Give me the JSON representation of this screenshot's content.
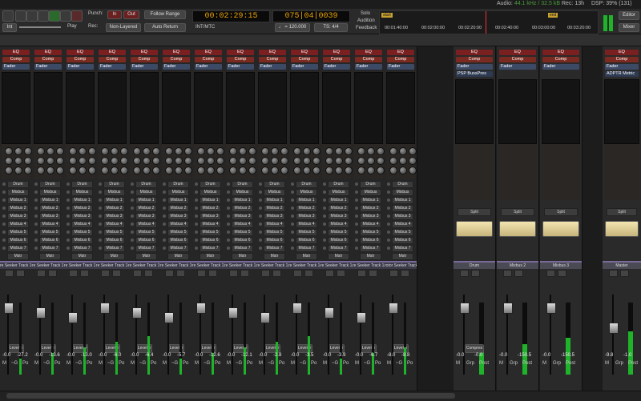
{
  "status": {
    "audio_label": "Audio:",
    "audio_val": "44.1 kHz / 32.5 kB",
    "rec": "Rec: 13h",
    "dsp": "DSP: 39% (131)"
  },
  "toolbar": {
    "int": "Int",
    "play": "Play",
    "punch": "Punch:",
    "punch_in": "In",
    "punch_out": "Out",
    "rec_label": "Rec:",
    "rec_mode": "Non-Layered",
    "follow_range": "Follow Range",
    "auto_return": "Auto Return",
    "timecode": "00:02:29:15",
    "int_mtc": "INT/MTC",
    "bars": "075|04|0039",
    "tempo": "♩ = 120.000",
    "ts": "TS: 4/4",
    "solo": "Solo",
    "audition": "Audition",
    "feedback": "Feedback",
    "start": "start",
    "end": "end",
    "ruler": [
      "00:01:40:00",
      "00:02:00:00",
      "00:02:20:00",
      "00:02:40:00",
      "00:03:00:00",
      "00:03:20:00"
    ],
    "editor": "Editor",
    "mixer": "Mixer"
  },
  "inserts": {
    "eq": "EQ",
    "comp": "Comp",
    "fader": "Fader",
    "psp": "PSP BussPres",
    "adptr": "ADPTR Metric"
  },
  "sends": [
    "Drum",
    "Mixbus",
    "Mixbus 1",
    "Mixbus 2",
    "Mixbus 3",
    "Mixbus 4",
    "Mixbus 5",
    "Mixbus 6",
    "Mixbus 7",
    "Mixbus 8"
  ],
  "send_last": "Mstr",
  "split": "Split",
  "footer_labels": {
    "m": "M",
    "grp": "~G",
    "po": "Po"
  },
  "bus_footer": {
    "m": "M",
    "grp": "Grp",
    "post": "Post"
  },
  "leveler": "Leveler",
  "comp_label": "Compres",
  "mixbus_names": [
    "Drum",
    "Mixbus 2",
    "Mixbus 3",
    "Master"
  ],
  "tracks": [
    {
      "name": "re Seeker Track 16",
      "vol": "-0.0",
      "pan": "-27.2"
    },
    {
      "name": "re Seeker Track 17",
      "vol": "-0.0",
      "pan": "-13.6"
    },
    {
      "name": "re Seeker Track 17",
      "vol": "-0.0",
      "pan": "-13.0"
    },
    {
      "name": "re Seeker Track 18",
      "vol": "-0.0",
      "pan": "-6.0"
    },
    {
      "name": "re Seeker Track 19",
      "vol": "-0.0",
      "pan": "-6.4"
    },
    {
      "name": "re Seeker Track 10",
      "vol": "-0.0",
      "pan": "-5.7"
    },
    {
      "name": "re Seeker Track 11",
      "vol": "-0.0",
      "pan": "-12.6"
    },
    {
      "name": "re Seeker Track 12",
      "vol": "-0.0",
      "pan": "-12.1"
    },
    {
      "name": "re Seeker Track 13",
      "vol": "-0.0",
      "pan": "-2.8"
    },
    {
      "name": "re Seeker Track 14",
      "vol": "-0.0",
      "pan": "-3.5"
    },
    {
      "name": "re Seeker Track 12",
      "vol": "-0.0",
      "pan": "-3.9"
    },
    {
      "name": "re Seeker Track 13",
      "vol": "-0.0",
      "pan": "-6.7"
    },
    {
      "name": "rotor Seeker Track 14",
      "vol": "-8.0",
      "pan": "-8.8"
    }
  ],
  "buses": [
    {
      "name": "Drum",
      "vol": "-0.0",
      "pan": "-0.0",
      "num": "1"
    },
    {
      "name": "Mixbus 2",
      "vol": "-0.0",
      "pan": "-150.5",
      "num": "2"
    },
    {
      "name": "Mixbus 3",
      "vol": "-0.0",
      "pan": "-150.5",
      "num": "3"
    },
    {
      "name": "Master",
      "vol": "-9.8",
      "pan": "-1.0",
      "num": ""
    }
  ],
  "colors": {
    "accent": "#e8a000",
    "meter": "#1fb32a",
    "eq": "#7a2020",
    "fader_ins": "#3d4a66"
  }
}
